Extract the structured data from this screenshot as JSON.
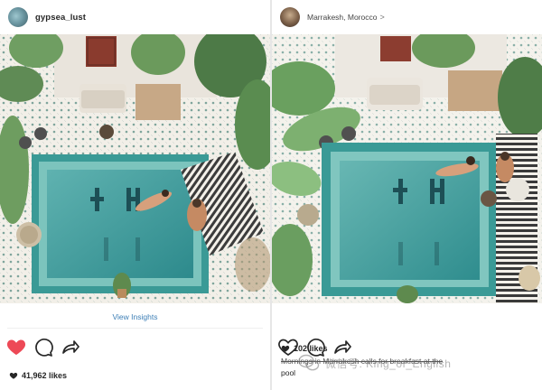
{
  "left_post": {
    "username": "gypsea_lust",
    "view_insights": "View Insights",
    "likes_count": "41,962 likes",
    "liked": true
  },
  "right_post": {
    "location": "Marrakesh, Morocco",
    "location_chevron": ">",
    "likes_count": "102 likes",
    "caption": "Mornings in Marrakesh calls for breakfast at the",
    "caption_line2": "pool"
  },
  "watermark": {
    "text": "微信号: King_of_English"
  },
  "colors": {
    "like_red": "#ed4956",
    "link_blue": "#3d7fb6",
    "pool_teal": "#2c8c8e"
  },
  "icons": [
    "heart-icon",
    "comment-icon",
    "share-icon"
  ]
}
